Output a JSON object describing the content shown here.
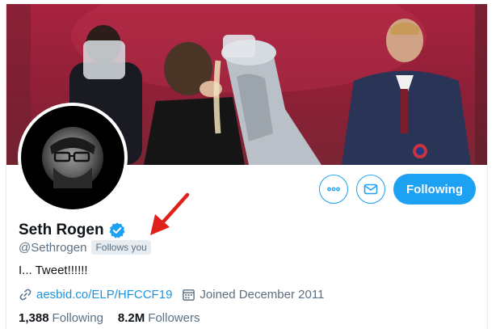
{
  "profile": {
    "name": "Seth Rogen",
    "handle": "@Sethrogen",
    "follows_you": "Follows you",
    "bio": "I... Tweet!!!!!!",
    "website": "aesbid.co/ELP/HFCCF19",
    "joined": "Joined December 2011"
  },
  "stats": {
    "following_count": "1,388",
    "following_label": "Following",
    "followers_count": "8.2M",
    "followers_label": "Followers"
  },
  "actions": {
    "following_button": "Following",
    "more_icon": "more-icon",
    "message_icon": "envelope-icon"
  },
  "icons": {
    "verified": "verified-badge-icon",
    "link": "link-icon",
    "calendar": "calendar-icon"
  },
  "colors": {
    "accent": "#1da1f2",
    "link": "#1b95e0",
    "secondary_text": "#5b7083",
    "annotation_arrow": "#e0201b"
  }
}
